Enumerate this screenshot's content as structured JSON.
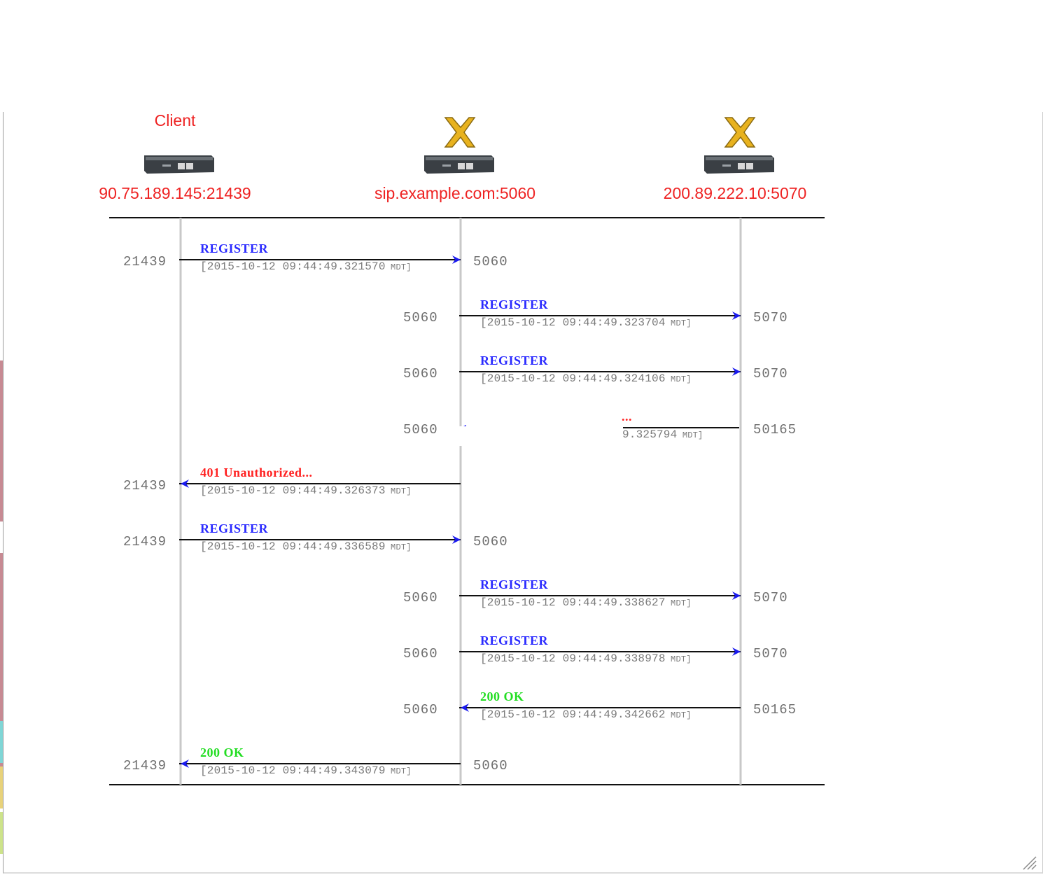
{
  "colors": {
    "request": "#2a2aff",
    "error": "#ff2222",
    "success": "#22dd22",
    "node_label": "#ee2222",
    "lifeline": "#c8c8c8",
    "arrow": "#111111"
  },
  "nodes": [
    {
      "id": "client",
      "role_label": "Client",
      "address": "90.75.189.145:21439",
      "icon": "device-icon"
    },
    {
      "id": "proxy",
      "role_label": "",
      "address": "sip.example.com:5060",
      "icon": "x-server-device-icon"
    },
    {
      "id": "registrar",
      "role_label": "",
      "address": "200.89.222.10:5070",
      "icon": "x-server-device-icon"
    }
  ],
  "messages": [
    {
      "from": 0,
      "to": 1,
      "label": "REGISTER",
      "kind": "request",
      "timestamp": "[2015-10-12 09:44:49.321570",
      "tz": "MDT]",
      "port_left": "21439",
      "port_right": "5060"
    },
    {
      "from": 1,
      "to": 2,
      "label": "REGISTER",
      "kind": "request",
      "timestamp": "[2015-10-12 09:44:49.323704",
      "tz": "MDT]",
      "port_left": "5060",
      "port_right": "5070"
    },
    {
      "from": 1,
      "to": 2,
      "label": "REGISTER",
      "kind": "request",
      "timestamp": "[2015-10-12 09:44:49.324106",
      "tz": "MDT]",
      "port_left": "5060",
      "port_right": "5070"
    },
    {
      "from": 2,
      "to": 1,
      "label": "...",
      "kind": "error",
      "timestamp": "9.325794",
      "tz": "MDT]",
      "port_left": "5060",
      "port_right": "50165",
      "partial": true
    },
    {
      "from": 1,
      "to": 0,
      "label": "401 Unauthorized...",
      "kind": "error",
      "timestamp": "[2015-10-12 09:44:49.326373",
      "tz": "MDT]",
      "port_left": "21439",
      "port_right": ""
    },
    {
      "from": 0,
      "to": 1,
      "label": "REGISTER",
      "kind": "request",
      "timestamp": "[2015-10-12 09:44:49.336589",
      "tz": "MDT]",
      "port_left": "21439",
      "port_right": "5060"
    },
    {
      "from": 1,
      "to": 2,
      "label": "REGISTER",
      "kind": "request",
      "timestamp": "[2015-10-12 09:44:49.338627",
      "tz": "MDT]",
      "port_left": "5060",
      "port_right": "5070"
    },
    {
      "from": 1,
      "to": 2,
      "label": "REGISTER",
      "kind": "request",
      "timestamp": "[2015-10-12 09:44:49.338978",
      "tz": "MDT]",
      "port_left": "5060",
      "port_right": "5070"
    },
    {
      "from": 2,
      "to": 1,
      "label": "200 OK",
      "kind": "success",
      "timestamp": "[2015-10-12 09:44:49.342662",
      "tz": "MDT]",
      "port_left": "5060",
      "port_right": "50165"
    },
    {
      "from": 1,
      "to": 0,
      "label": "200 OK",
      "kind": "success",
      "timestamp": "[2015-10-12 09:44:49.343079",
      "tz": "MDT]",
      "port_left": "21439",
      "port_right": "5060"
    }
  ]
}
